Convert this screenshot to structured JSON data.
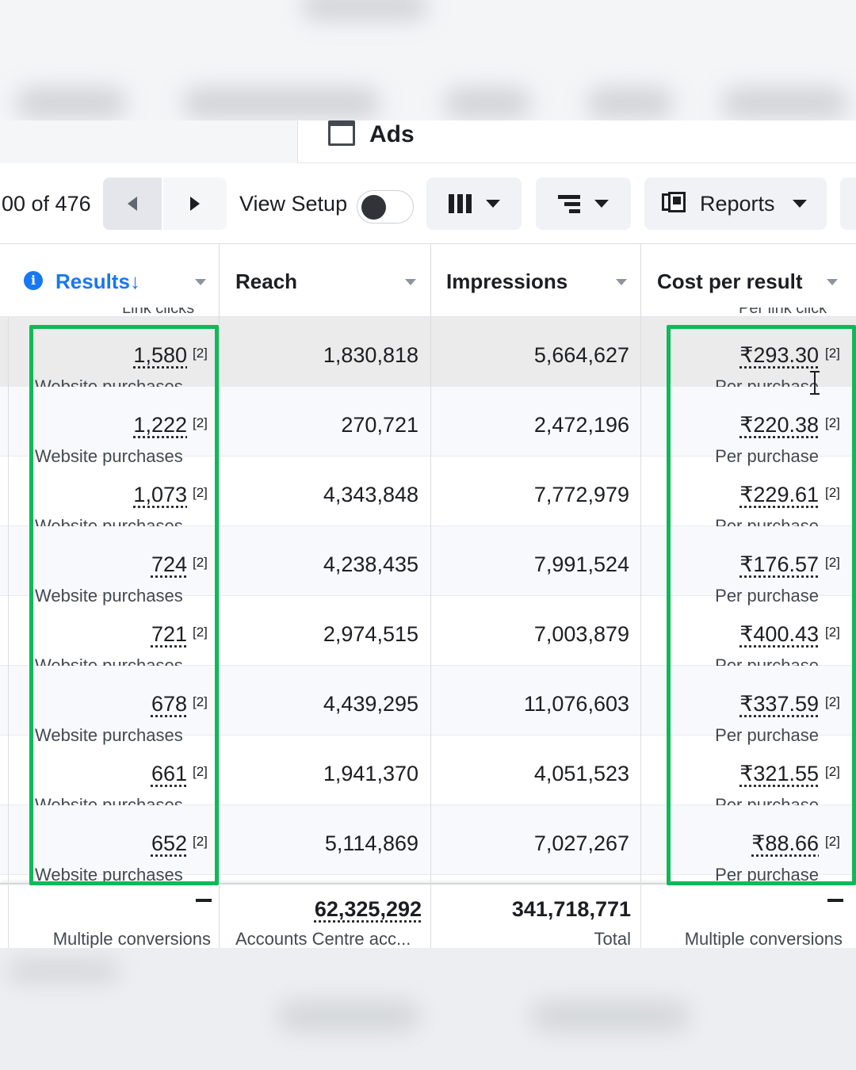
{
  "ads_header": {
    "title": "Ads",
    "icon": "ad-set-icon"
  },
  "toolbar": {
    "pager_text": "00 of 476",
    "prev_icon": "caret-left-icon",
    "next_icon": "caret-right-icon",
    "view_setup_label": "View Setup",
    "view_setup_on": false,
    "columns_icon": "columns-icon",
    "breakdown_icon": "breakdown-icon",
    "reports_label": "Reports",
    "reports_icon": "reports-icon"
  },
  "columns": [
    {
      "label": "Results",
      "sorted": "descending",
      "sub": "Link clicks",
      "accent": "#1877f2"
    },
    {
      "label": "Reach"
    },
    {
      "label": "Impressions"
    },
    {
      "label": "Cost per result",
      "sub": "Per link click"
    }
  ],
  "rows": [
    {
      "results": "1,580",
      "results_note": "[2]",
      "results_sub": "Website purchases",
      "reach": "1,830,818",
      "impressions": "5,664,627",
      "cost": "₹293.30",
      "cost_note": "[2]",
      "cost_sub": "Per purchase"
    },
    {
      "results": "1,222",
      "results_note": "[2]",
      "results_sub": "Website purchases",
      "reach": "270,721",
      "impressions": "2,472,196",
      "cost": "₹220.38",
      "cost_note": "[2]",
      "cost_sub": "Per purchase"
    },
    {
      "results": "1,073",
      "results_note": "[2]",
      "results_sub": "Website purchases",
      "reach": "4,343,848",
      "impressions": "7,772,979",
      "cost": "₹229.61",
      "cost_note": "[2]",
      "cost_sub": "Per purchase"
    },
    {
      "results": "724",
      "results_note": "[2]",
      "results_sub": "Website purchases",
      "reach": "4,238,435",
      "impressions": "7,991,524",
      "cost": "₹176.57",
      "cost_note": "[2]",
      "cost_sub": "Per purchase"
    },
    {
      "results": "721",
      "results_note": "[2]",
      "results_sub": "Website purchases",
      "reach": "2,974,515",
      "impressions": "7,003,879",
      "cost": "₹400.43",
      "cost_note": "[2]",
      "cost_sub": "Per purchase"
    },
    {
      "results": "678",
      "results_note": "[2]",
      "results_sub": "Website purchases",
      "reach": "4,439,295",
      "impressions": "11,076,603",
      "cost": "₹337.59",
      "cost_note": "[2]",
      "cost_sub": "Per purchase"
    },
    {
      "results": "661",
      "results_note": "[2]",
      "results_sub": "Website purchases",
      "reach": "1,941,370",
      "impressions": "4,051,523",
      "cost": "₹321.55",
      "cost_note": "[2]",
      "cost_sub": "Per purchase"
    },
    {
      "results": "652",
      "results_note": "[2]",
      "results_sub": "Website purchases",
      "reach": "5,114,869",
      "impressions": "7,027,267",
      "cost": "₹88.66",
      "cost_note": "[2]",
      "cost_sub": "Per purchase"
    }
  ],
  "totals": {
    "results": "—",
    "results_sub": "Multiple conversions",
    "reach": "62,325,292",
    "reach_sub": "Accounts Centre acc...",
    "impressions": "341,718,771",
    "impressions_sub": "Total",
    "cost": "—",
    "cost_sub": "Multiple conversions"
  },
  "highlight_color": "#10b958"
}
